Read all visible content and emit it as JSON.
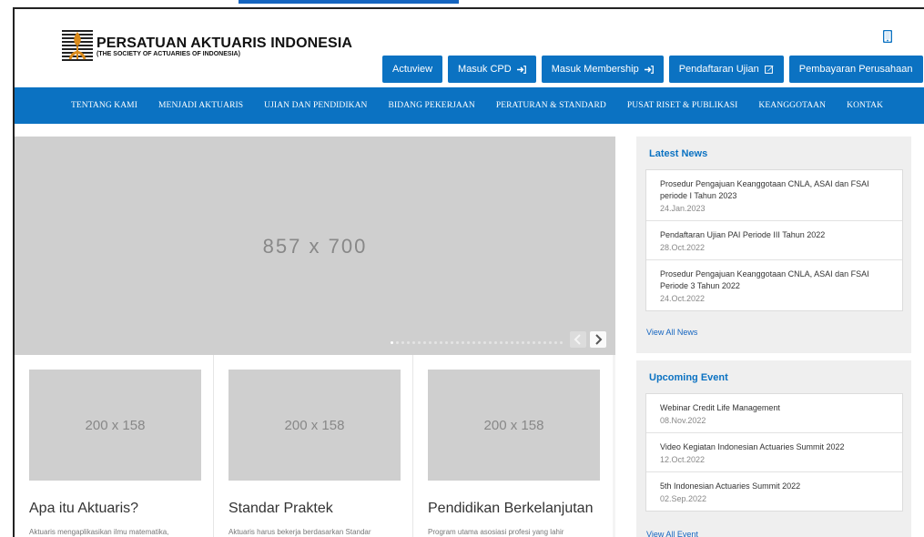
{
  "header": {
    "org_name": "PERSATUAN AKTUARIS INDONESIA",
    "org_sub": "(THE SOCIETY OF ACTUARIES OF INDONESIA)",
    "buttons": [
      "Actuview",
      "Masuk CPD",
      "Masuk Membership",
      "Pendaftaran Ujian",
      "Pembayaran Perusahaan"
    ]
  },
  "nav": {
    "items": [
      "TENTANG KAMI",
      "MENJADI AKTUARIS",
      "UJIAN DAN PENDIDIKAN",
      "BIDANG PEKERJAAN",
      "PERATURAN & STANDARD",
      "PUSAT RISET & PUBLIKASI",
      "KEANGGOTAAN",
      "KONTAK"
    ]
  },
  "slider": {
    "placeholder": "857 x 700"
  },
  "features": [
    {
      "image": "200 x 158",
      "title": "Apa itu Aktuaris?",
      "text": "Aktuaris mengaplikasikan ilmu matematika,"
    },
    {
      "image": "200 x 158",
      "title": "Standar Praktek",
      "text": "Aktuaris harus bekerja berdasarkan Standar"
    },
    {
      "image": "200 x 158",
      "title": "Pendidikan Berkelanjutan",
      "text": "Program utama asosiasi profesi yang lahir"
    }
  ],
  "news": {
    "title": "Latest News",
    "items": [
      {
        "title": "Prosedur Pengajuan Keanggotaan CNLA, ASAI dan FSAI periode I Tahun 2023",
        "date": "24.Jan.2023"
      },
      {
        "title": "Pendaftaran Ujian PAI Periode III Tahun 2022",
        "date": "28.Oct.2022"
      },
      {
        "title": "Prosedur Pengajuan Keanggotaan CNLA, ASAI dan FSAI Periode 3 Tahun 2022",
        "date": "24.Oct.2022"
      }
    ],
    "view_all": "View All News"
  },
  "events": {
    "title": "Upcoming Event",
    "items": [
      {
        "title": "Webinar Credit Life Management",
        "date": "08.Nov.2022"
      },
      {
        "title": "Video Kegiatan Indonesian Actuaries Summit 2022",
        "date": "12.Oct.2022"
      },
      {
        "title": "5th Indonesian Actuaries Summit 2022",
        "date": "02.Sep.2022"
      }
    ],
    "view_all": "View All Event"
  },
  "colors": {
    "brand": "#0b72c2",
    "link": "#1565c0"
  },
  "icons": {
    "phone": "mobile-phone-icon",
    "login": "sign-in-icon",
    "edit": "edit-icon",
    "prev": "chevron-left-icon",
    "next": "chevron-right-icon"
  }
}
